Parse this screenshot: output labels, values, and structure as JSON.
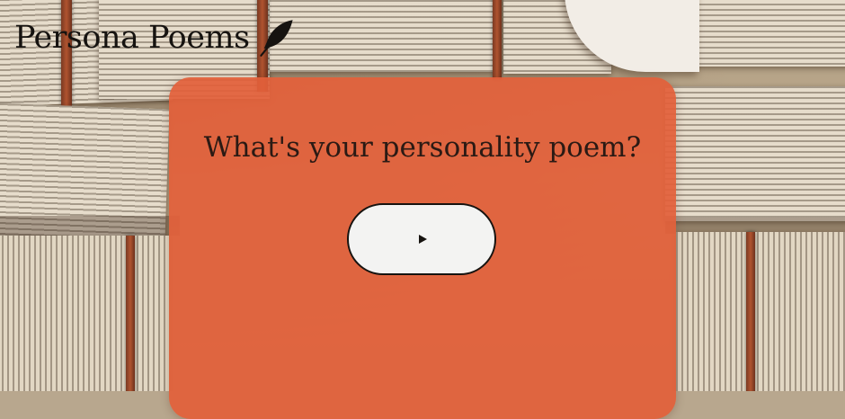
{
  "header": {
    "app_title": "Persona Poems",
    "logo_icon": "feather-icon"
  },
  "main": {
    "question": "What's your personality poem?",
    "start_button_icon": "play-icon"
  },
  "colors": {
    "card": "#e2603a",
    "button_bg": "#f3f3f2",
    "text_dark": "#161310"
  }
}
